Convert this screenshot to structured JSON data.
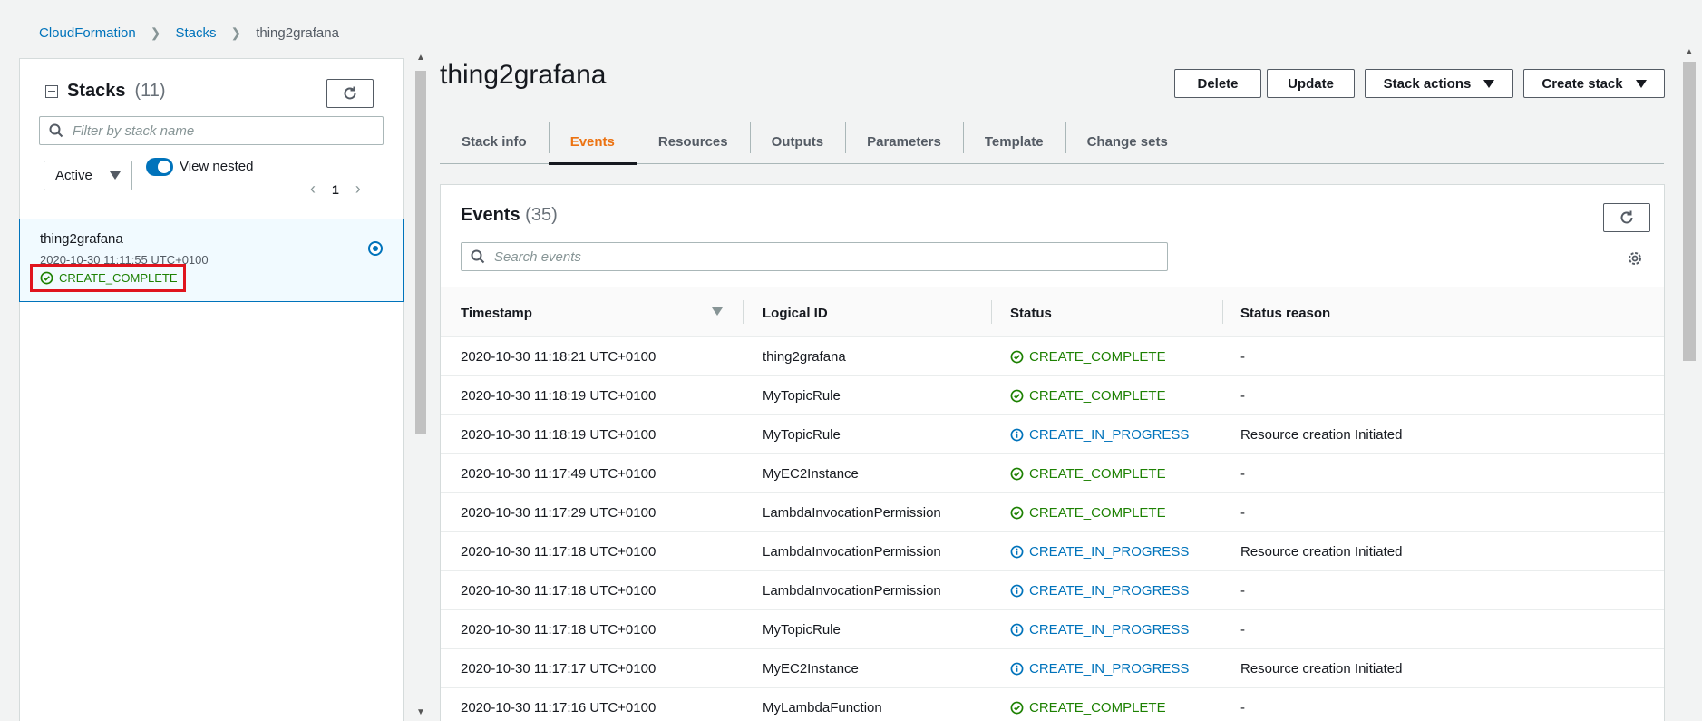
{
  "breadcrumb": {
    "root": "CloudFormation",
    "stacks": "Stacks",
    "current": "thing2grafana"
  },
  "left_panel": {
    "title": "Stacks",
    "count": "(11)",
    "filter_placeholder": "Filter by stack name",
    "status_filter": "Active",
    "view_nested_label": "View nested",
    "page": "1",
    "stack": {
      "name": "thing2grafana",
      "date": "2020-10-30 11:11:55 UTC+0100",
      "status": "CREATE_COMPLETE"
    }
  },
  "header": {
    "title": "thing2grafana",
    "buttons": {
      "delete": "Delete",
      "update": "Update",
      "stack_actions": "Stack actions",
      "create_stack": "Create stack"
    }
  },
  "tabs": [
    "Stack info",
    "Events",
    "Resources",
    "Outputs",
    "Parameters",
    "Template",
    "Change sets"
  ],
  "active_tab": "Events",
  "events": {
    "title": "Events",
    "count": "(35)",
    "search_placeholder": "Search events",
    "columns": [
      "Timestamp",
      "Logical ID",
      "Status",
      "Status reason"
    ],
    "rows": [
      {
        "timestamp": "2020-10-30 11:18:21 UTC+0100",
        "logical_id": "thing2grafana",
        "status": "CREATE_COMPLETE",
        "reason": "-"
      },
      {
        "timestamp": "2020-10-30 11:18:19 UTC+0100",
        "logical_id": "MyTopicRule",
        "status": "CREATE_COMPLETE",
        "reason": "-"
      },
      {
        "timestamp": "2020-10-30 11:18:19 UTC+0100",
        "logical_id": "MyTopicRule",
        "status": "CREATE_IN_PROGRESS",
        "reason": "Resource creation Initiated"
      },
      {
        "timestamp": "2020-10-30 11:17:49 UTC+0100",
        "logical_id": "MyEC2Instance",
        "status": "CREATE_COMPLETE",
        "reason": "-"
      },
      {
        "timestamp": "2020-10-30 11:17:29 UTC+0100",
        "logical_id": "LambdaInvocationPermission",
        "status": "CREATE_COMPLETE",
        "reason": "-"
      },
      {
        "timestamp": "2020-10-30 11:17:18 UTC+0100",
        "logical_id": "LambdaInvocationPermission",
        "status": "CREATE_IN_PROGRESS",
        "reason": "Resource creation Initiated"
      },
      {
        "timestamp": "2020-10-30 11:17:18 UTC+0100",
        "logical_id": "LambdaInvocationPermission",
        "status": "CREATE_IN_PROGRESS",
        "reason": "-"
      },
      {
        "timestamp": "2020-10-30 11:17:18 UTC+0100",
        "logical_id": "MyTopicRule",
        "status": "CREATE_IN_PROGRESS",
        "reason": "-"
      },
      {
        "timestamp": "2020-10-30 11:17:17 UTC+0100",
        "logical_id": "MyEC2Instance",
        "status": "CREATE_IN_PROGRESS",
        "reason": "Resource creation Initiated"
      },
      {
        "timestamp": "2020-10-30 11:17:16 UTC+0100",
        "logical_id": "MyLambdaFunction",
        "status": "CREATE_COMPLETE",
        "reason": "-"
      }
    ]
  },
  "colors": {
    "link": "#0073bb",
    "success": "#1d8102",
    "active_tab": "#ec7211",
    "highlight": "#e0141e"
  }
}
